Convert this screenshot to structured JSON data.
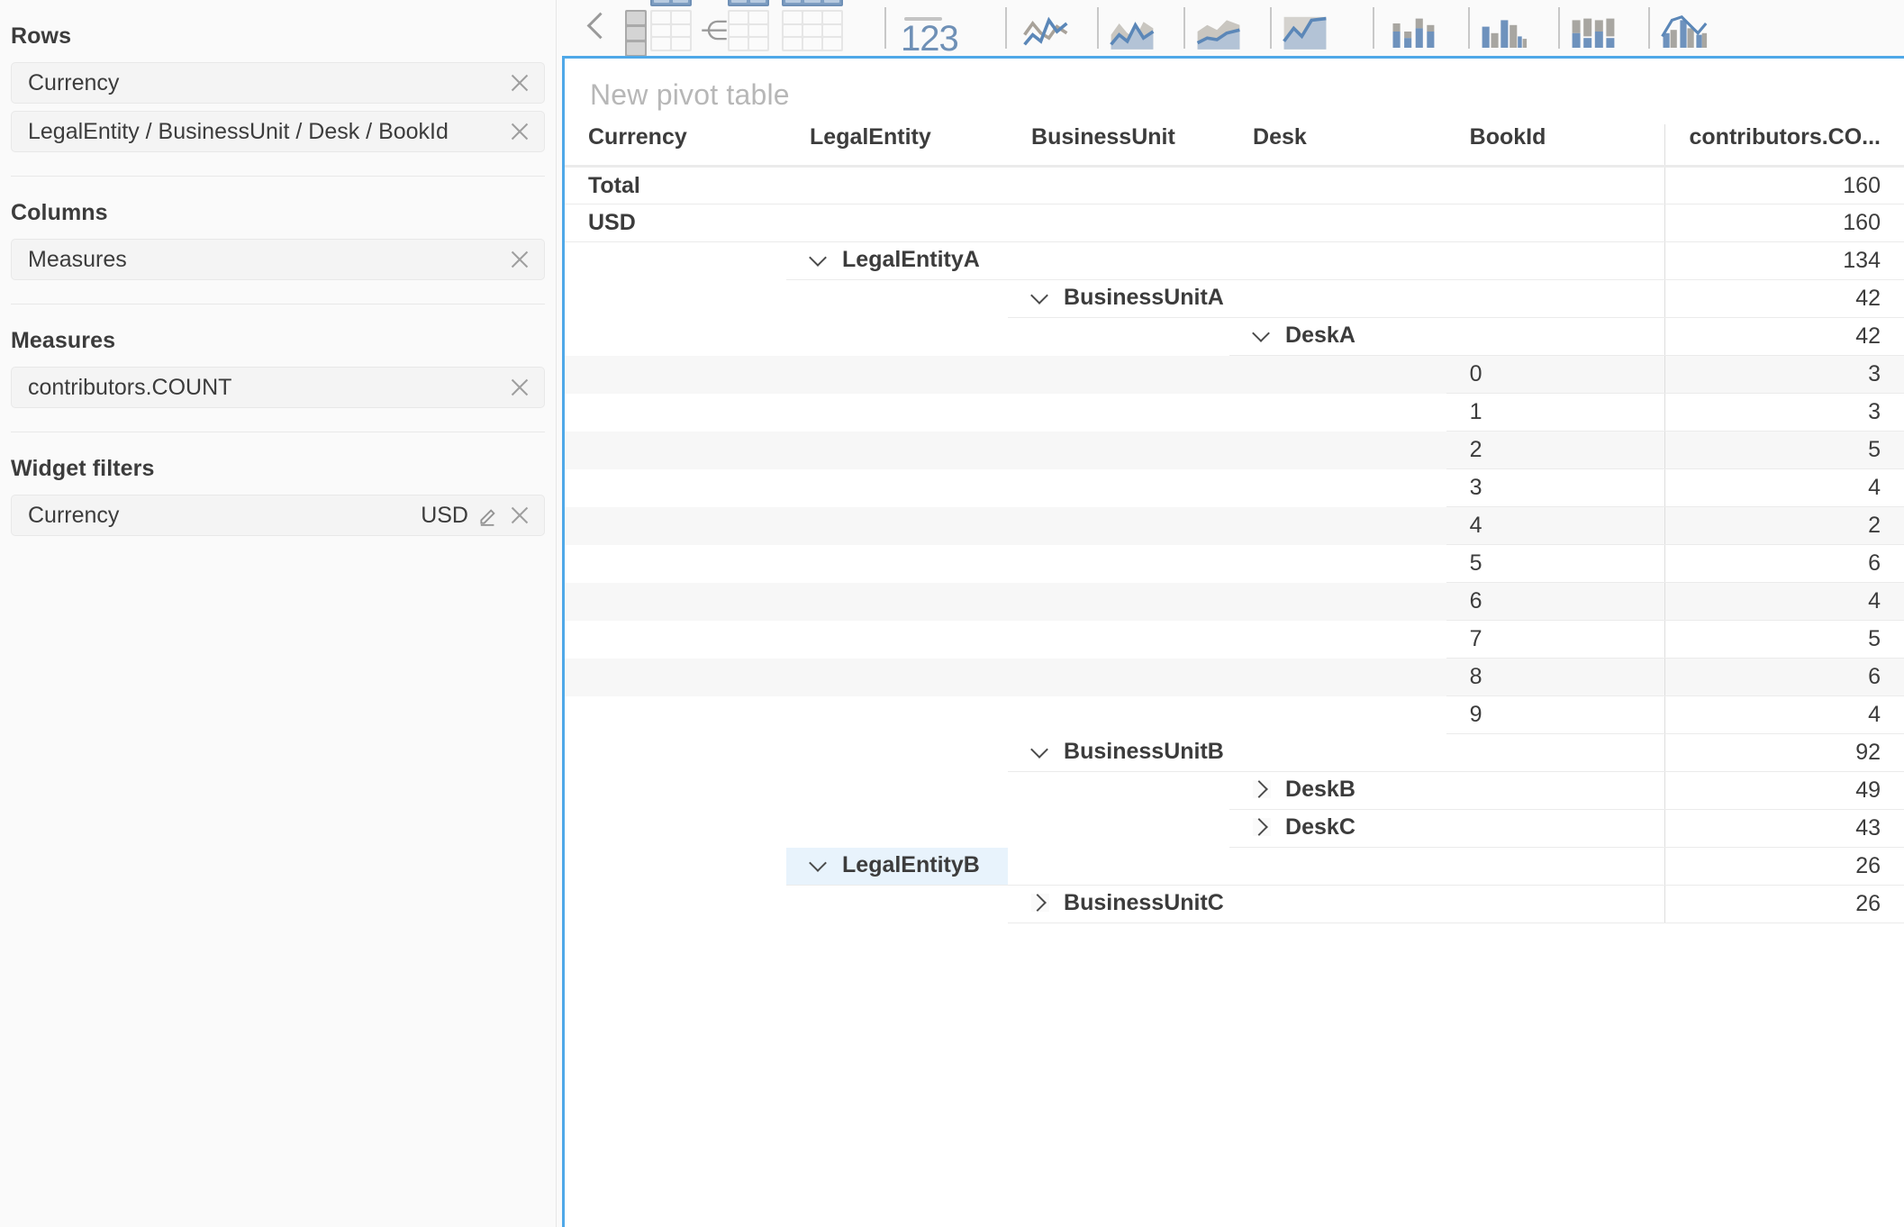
{
  "sidebar": {
    "sections": [
      {
        "title": "Rows",
        "chips": [
          {
            "label": "Currency",
            "value": "",
            "has_edit": false
          },
          {
            "label": "LegalEntity / BusinessUnit / Desk / BookId",
            "value": "",
            "has_edit": false
          }
        ]
      },
      {
        "title": "Columns",
        "chips": [
          {
            "label": "Measures",
            "value": "",
            "has_edit": false
          }
        ]
      },
      {
        "title": "Measures",
        "chips": [
          {
            "label": "contributors.COUNT",
            "value": "",
            "has_edit": false
          }
        ]
      },
      {
        "title": "Widget filters",
        "chips": [
          {
            "label": "Currency",
            "value": "USD",
            "has_edit": true
          }
        ]
      }
    ]
  },
  "toolbar": {
    "collapse_label": "Collapse panel",
    "buttons": [
      {
        "name": "pivot-table-icon",
        "label": "Pivot table"
      },
      {
        "name": "tree-table-icon",
        "label": "Tree table"
      },
      {
        "name": "plain-table-icon",
        "label": "Plain table"
      },
      {
        "name": "kpi-number-icon",
        "label": "123"
      },
      {
        "name": "line-chart-icon",
        "label": "Line chart"
      },
      {
        "name": "area-line-chart-icon",
        "label": "Area line chart"
      },
      {
        "name": "stacked-area-chart-icon",
        "label": "Stacked area chart"
      },
      {
        "name": "filled-area-chart-icon",
        "label": "Filled area chart"
      },
      {
        "name": "stacked-bar-chart-icon",
        "label": "Stacked bar chart"
      },
      {
        "name": "column-chart-icon",
        "label": "Column chart"
      },
      {
        "name": "stacked-column-chart-icon",
        "label": "Stacked column chart"
      },
      {
        "name": "combo-chart-icon",
        "label": "Combo chart"
      }
    ],
    "kpi_text": "123"
  },
  "widget": {
    "title": "New pivot table",
    "accent_color": "#4fa8e8",
    "highlight_color": "#e8f3fc"
  },
  "table": {
    "headers": [
      "Currency",
      "LegalEntity",
      "BusinessUnit",
      "Desk",
      "BookId",
      "contributors.CO..."
    ],
    "measure_full_name": "contributors.COUNT",
    "rows": [
      {
        "level": 0,
        "col": "currency",
        "label": "Total",
        "value": "160",
        "chevron": "none",
        "bold": true,
        "alt": false,
        "highlight": false
      },
      {
        "level": 0,
        "col": "currency",
        "label": "USD",
        "value": "160",
        "chevron": "none",
        "bold": true,
        "alt": false,
        "highlight": false
      },
      {
        "level": 1,
        "col": "legalentity",
        "label": "LegalEntityA",
        "value": "134",
        "chevron": "down",
        "bold": true,
        "alt": false,
        "highlight": false
      },
      {
        "level": 2,
        "col": "businessunit",
        "label": "BusinessUnitA",
        "value": "42",
        "chevron": "down",
        "bold": true,
        "alt": false,
        "highlight": false
      },
      {
        "level": 3,
        "col": "desk",
        "label": "DeskA",
        "value": "42",
        "chevron": "down",
        "bold": true,
        "alt": false,
        "highlight": false
      },
      {
        "level": 4,
        "col": "bookid",
        "label": "0",
        "value": "3",
        "chevron": "none",
        "bold": false,
        "alt": true,
        "highlight": false
      },
      {
        "level": 4,
        "col": "bookid",
        "label": "1",
        "value": "3",
        "chevron": "none",
        "bold": false,
        "alt": false,
        "highlight": false
      },
      {
        "level": 4,
        "col": "bookid",
        "label": "2",
        "value": "5",
        "chevron": "none",
        "bold": false,
        "alt": true,
        "highlight": false
      },
      {
        "level": 4,
        "col": "bookid",
        "label": "3",
        "value": "4",
        "chevron": "none",
        "bold": false,
        "alt": false,
        "highlight": false
      },
      {
        "level": 4,
        "col": "bookid",
        "label": "4",
        "value": "2",
        "chevron": "none",
        "bold": false,
        "alt": true,
        "highlight": false
      },
      {
        "level": 4,
        "col": "bookid",
        "label": "5",
        "value": "6",
        "chevron": "none",
        "bold": false,
        "alt": false,
        "highlight": false
      },
      {
        "level": 4,
        "col": "bookid",
        "label": "6",
        "value": "4",
        "chevron": "none",
        "bold": false,
        "alt": true,
        "highlight": false
      },
      {
        "level": 4,
        "col": "bookid",
        "label": "7",
        "value": "5",
        "chevron": "none",
        "bold": false,
        "alt": false,
        "highlight": false
      },
      {
        "level": 4,
        "col": "bookid",
        "label": "8",
        "value": "6",
        "chevron": "none",
        "bold": false,
        "alt": true,
        "highlight": false
      },
      {
        "level": 4,
        "col": "bookid",
        "label": "9",
        "value": "4",
        "chevron": "none",
        "bold": false,
        "alt": false,
        "highlight": false
      },
      {
        "level": 2,
        "col": "businessunit",
        "label": "BusinessUnitB",
        "value": "92",
        "chevron": "down",
        "bold": true,
        "alt": false,
        "highlight": false
      },
      {
        "level": 3,
        "col": "desk",
        "label": "DeskB",
        "value": "49",
        "chevron": "right",
        "bold": true,
        "alt": false,
        "highlight": false
      },
      {
        "level": 3,
        "col": "desk",
        "label": "DeskC",
        "value": "43",
        "chevron": "right",
        "bold": true,
        "alt": false,
        "highlight": false
      },
      {
        "level": 1,
        "col": "legalentity",
        "label": "LegalEntityB",
        "value": "26",
        "chevron": "down",
        "bold": true,
        "alt": false,
        "highlight": true
      },
      {
        "level": 2,
        "col": "businessunit",
        "label": "BusinessUnitC",
        "value": "26",
        "chevron": "right",
        "bold": true,
        "alt": false,
        "highlight": false
      }
    ]
  }
}
